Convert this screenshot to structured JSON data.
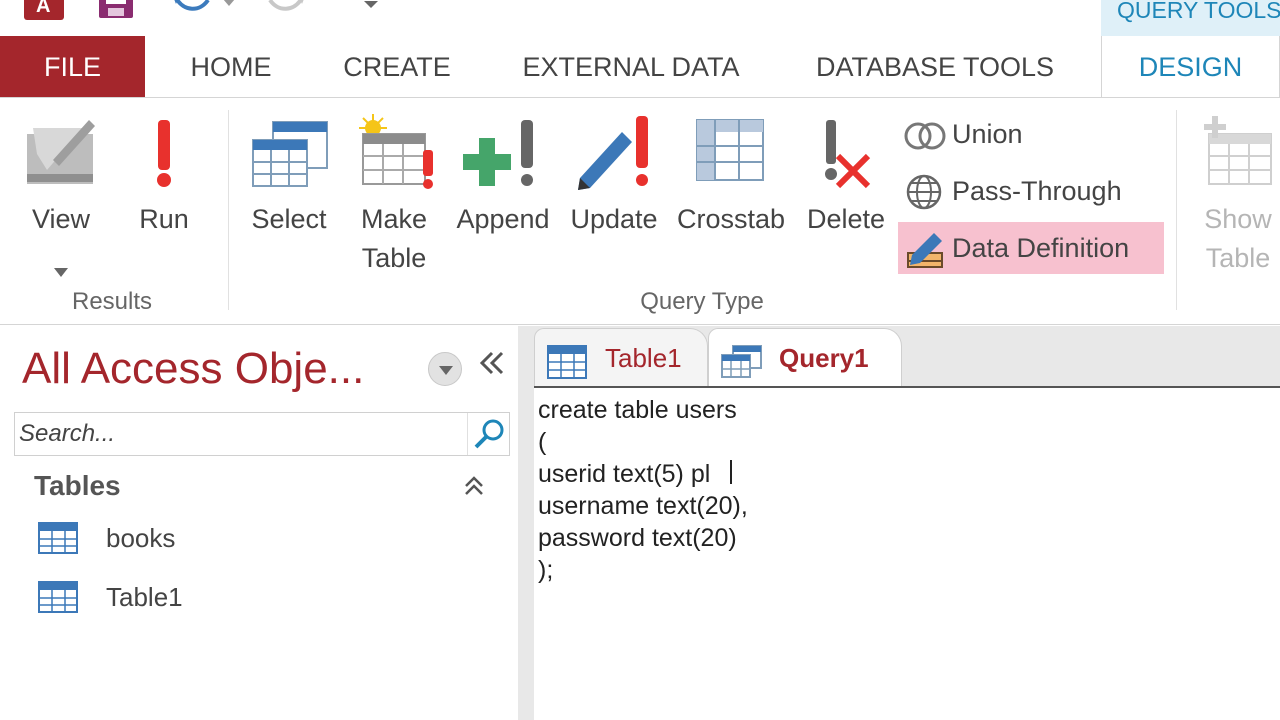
{
  "qat": {
    "icons": [
      "access-app-icon",
      "save-icon",
      "undo-icon",
      "redo-icon",
      "customize-dropdown-icon"
    ]
  },
  "contextual_header": "QUERY TOOLS",
  "ribbon_tabs": {
    "file": "FILE",
    "home": "HOME",
    "create": "CREATE",
    "external_data": "EXTERNAL DATA",
    "database_tools": "DATABASE TOOLS",
    "design": "DESIGN"
  },
  "ribbon": {
    "results": {
      "group_label": "Results",
      "view": "View",
      "run": "Run"
    },
    "query_type": {
      "group_label": "Query Type",
      "select": "Select",
      "make_table_1": "Make",
      "make_table_2": "Table",
      "append": "Append",
      "update": "Update",
      "crosstab": "Crosstab",
      "delete": "Delete",
      "union": "Union",
      "pass_through": "Pass-Through",
      "data_definition": "Data Definition"
    },
    "query_setup": {
      "show_table_1": "Show",
      "show_table_2": "Table"
    },
    "colors": {
      "file_tab": "#a4262c",
      "contextual": "#1e86b8",
      "data_definition_highlight": "#f7c1cf"
    }
  },
  "nav_pane": {
    "title": "All Access Obje...",
    "search_placeholder": "Search...",
    "group": "Tables",
    "items": [
      {
        "label": "books"
      },
      {
        "label": "Table1"
      }
    ]
  },
  "documents": {
    "tabs": [
      {
        "label": "Table1",
        "active": false
      },
      {
        "label": "Query1",
        "active": true
      }
    ],
    "sql": "create table users\n(\nuserid text(5) pl\nusername text(20),\npassword text(20)\n);"
  }
}
